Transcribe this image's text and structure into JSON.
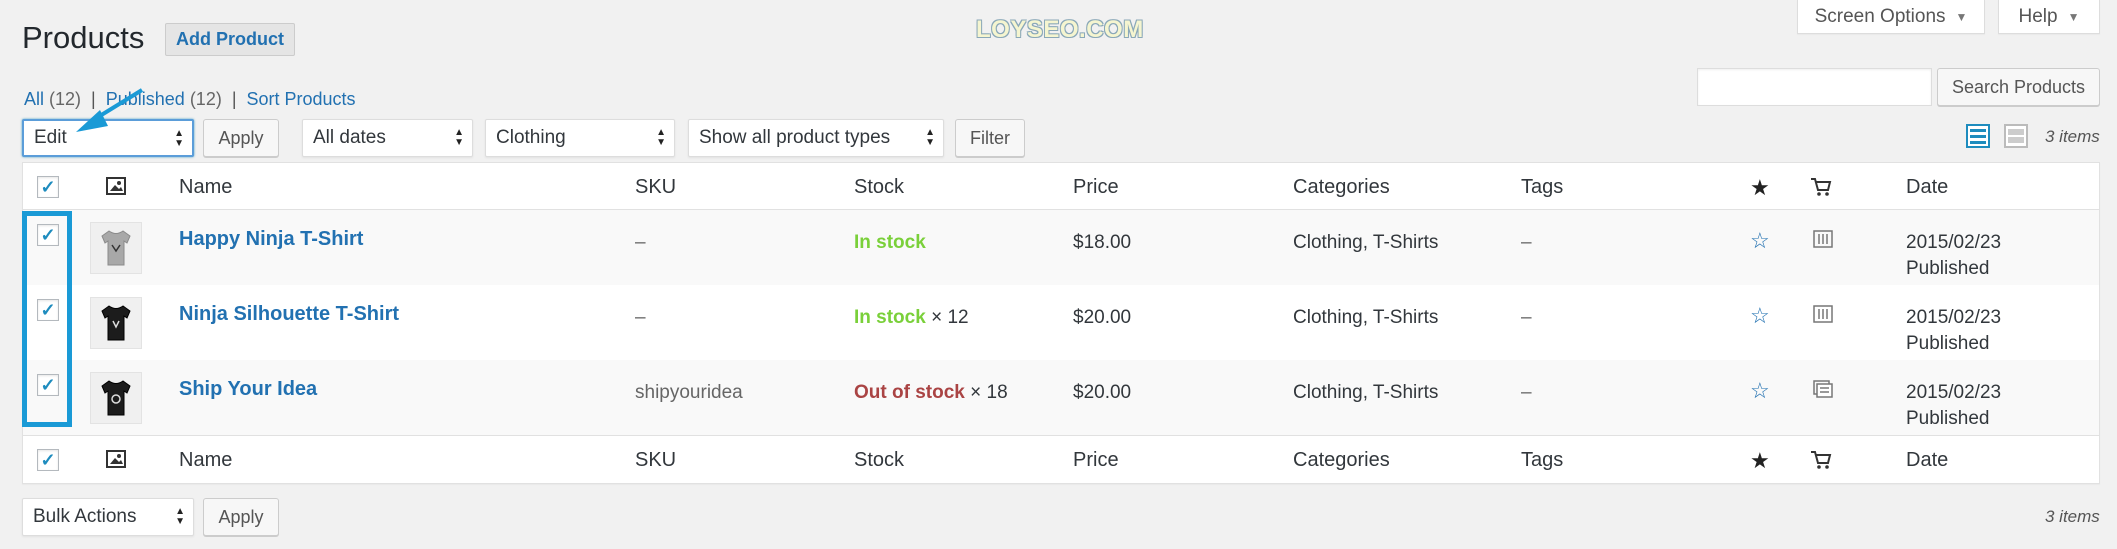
{
  "header": {
    "title": "Products",
    "add_button": "Add Product",
    "watermark": "LOYSEO.COM",
    "screen_options": "Screen Options",
    "help": "Help"
  },
  "filters": {
    "all_label": "All",
    "all_count": "(12)",
    "published_label": "Published",
    "published_count": "(12)",
    "sort_label": "Sort Products",
    "sep": "|"
  },
  "search": {
    "value": "",
    "button": "Search Products"
  },
  "toolbar_top": {
    "bulk_action": "Edit",
    "apply": "Apply",
    "dates": "All dates",
    "category": "Clothing",
    "product_type": "Show all product types",
    "filter": "Filter",
    "items_count": "3 items"
  },
  "toolbar_bottom": {
    "bulk_action": "Bulk Actions",
    "apply": "Apply",
    "items_count": "3 items"
  },
  "columns": {
    "name": "Name",
    "sku": "SKU",
    "stock": "Stock",
    "price": "Price",
    "categories": "Categories",
    "tags": "Tags",
    "date": "Date"
  },
  "rows": [
    {
      "name": "Happy Ninja T-Shirt",
      "sku": "–",
      "stock_status": "In stock",
      "stock_qty": "",
      "price": "$18.00",
      "categories": "Clothing, T-Shirts",
      "tags": "–",
      "date": "2015/02/23",
      "status": "Published",
      "checked": true,
      "shirt_color": "#9a9a9a"
    },
    {
      "name": "Ninja Silhouette T-Shirt",
      "sku": "–",
      "stock_status": "In stock",
      "stock_qty": "× 12",
      "price": "$20.00",
      "categories": "Clothing, T-Shirts",
      "tags": "–",
      "date": "2015/02/23",
      "status": "Published",
      "checked": true,
      "shirt_color": "#1c1c1c"
    },
    {
      "name": "Ship Your Idea",
      "sku": "shipyouridea",
      "stock_status": "Out of stock",
      "stock_qty": "× 18",
      "price": "$20.00",
      "categories": "Clothing, T-Shirts",
      "tags": "–",
      "date": "2015/02/23",
      "status": "Published",
      "checked": true,
      "shirt_color": "#1c1c1c"
    }
  ],
  "icons": {
    "featured": "star-icon",
    "type": "cart-icon",
    "thumbnail": "image-icon"
  },
  "colors": {
    "link": "#2271b1",
    "in_stock": "#7ad03a",
    "out_of_stock": "#aa4444",
    "annotation": "#1a9ad6"
  }
}
